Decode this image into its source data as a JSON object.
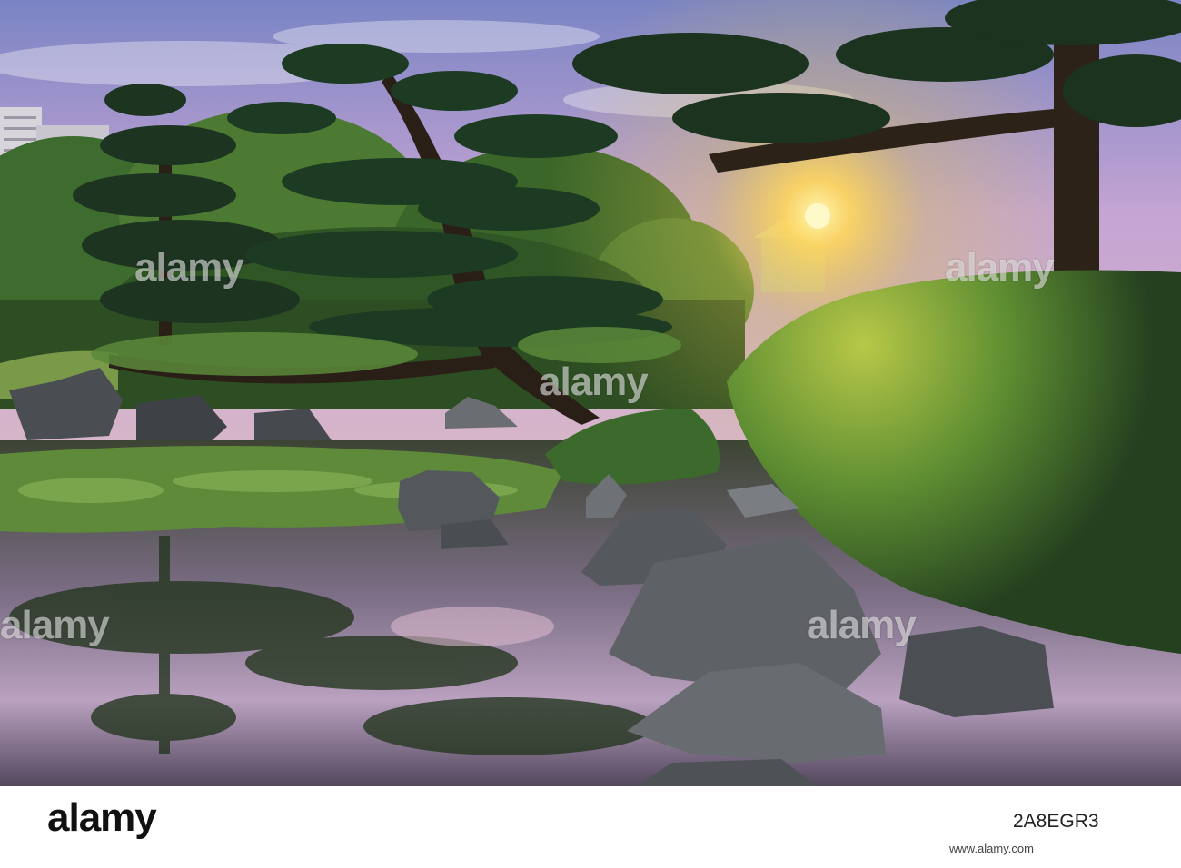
{
  "photo": {
    "subject": "Japanese garden pond at sunset",
    "colors": {
      "sky_top": "#7d86c4",
      "sky_mid": "#c7a7d6",
      "sun": "#ffe27a",
      "foliage_dark": "#1f3a24",
      "foliage_light": "#6f9c3c",
      "water": "#3b3f4a",
      "rock": "#4e5257"
    }
  },
  "watermarks": {
    "mark_1": "alamy",
    "mark_2": "alamy",
    "mark_3": "alamy",
    "mark_4": "alamy",
    "mark_5": "alamy"
  },
  "footer": {
    "logo": "alamy",
    "image_id": "2A8EGR3",
    "site": "www.alamy.com"
  }
}
